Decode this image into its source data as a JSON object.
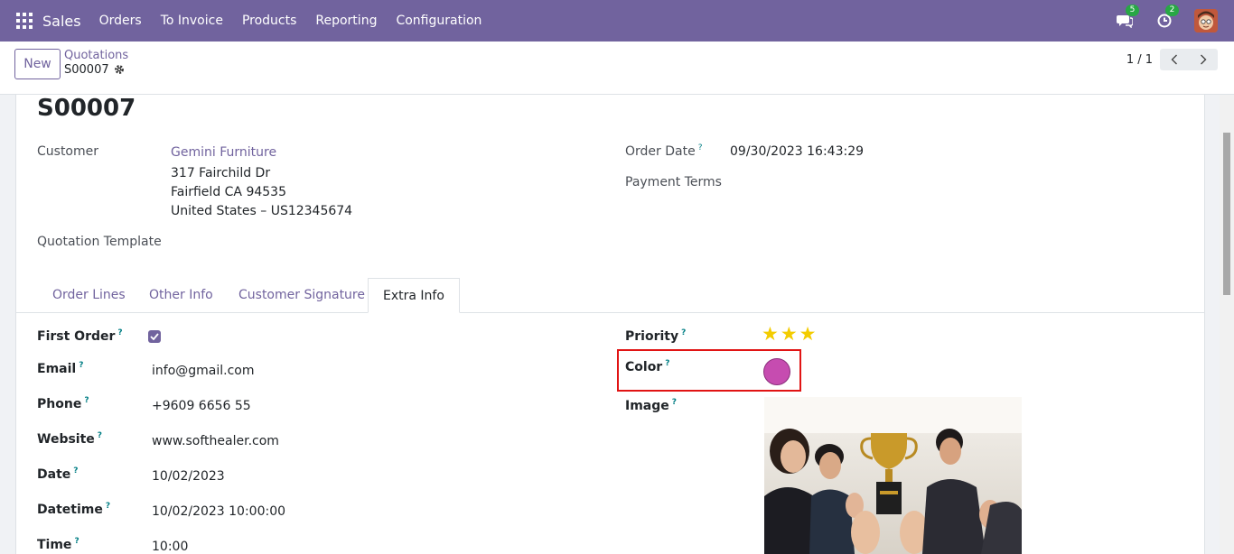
{
  "navbar": {
    "app_name": "Sales",
    "menu": [
      "Orders",
      "To Invoice",
      "Products",
      "Reporting",
      "Configuration"
    ],
    "messages_count": "5",
    "activities_count": "2"
  },
  "control_panel": {
    "new_label": "New",
    "breadcrumb_parent": "Quotations",
    "breadcrumb_current": "S00007",
    "pager": "1 / 1"
  },
  "record": {
    "name": "S00007",
    "customer_label": "Customer",
    "customer_name": "Gemini Furniture",
    "customer_address": [
      "317 Fairchild Dr",
      "Fairfield CA 94535",
      "United States – US12345674"
    ],
    "quotation_template_label": "Quotation Template",
    "order_date_label": "Order Date",
    "order_date_value": "09/30/2023 16:43:29",
    "payment_terms_label": "Payment Terms"
  },
  "tabs": [
    "Order Lines",
    "Other Info",
    "Customer Signature",
    "Extra Info"
  ],
  "active_tab": "Extra Info",
  "extra_info": {
    "first_order_label": "First Order",
    "first_order_checked": true,
    "email_label": "Email",
    "email_value": "info@gmail.com",
    "phone_label": "Phone",
    "phone_value": "+9609 6656 55",
    "website_label": "Website",
    "website_value": "www.softhealer.com",
    "date_label": "Date",
    "date_value": "10/02/2023",
    "datetime_label": "Datetime",
    "datetime_value": "10/02/2023 10:00:00",
    "time_label": "Time",
    "time_value": "10:00",
    "priority_label": "Priority",
    "priority_stars": 3,
    "color_label": "Color",
    "color_value": "#c64cb0",
    "image_label": "Image"
  },
  "help_marker": "?",
  "colors": {
    "brand": "#71639e",
    "highlight": "#e11414",
    "badge": "#28a745",
    "star": "#f3cc00"
  }
}
